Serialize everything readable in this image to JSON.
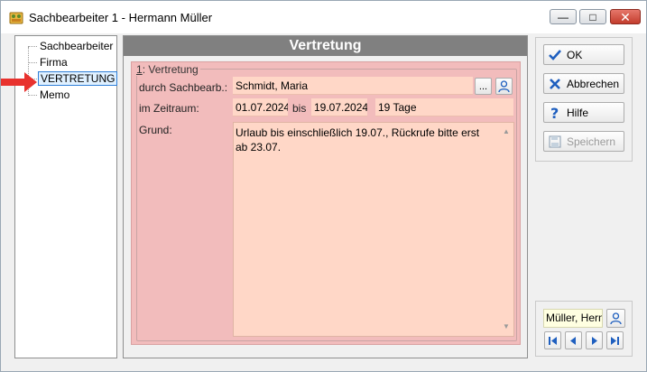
{
  "window": {
    "title": "Sachbearbeiter 1 - Hermann Müller",
    "minimize_glyph": "—",
    "maximize_glyph": "□",
    "close_glyph": "✕"
  },
  "tree": {
    "items": [
      {
        "label": "Sachbearbeiter",
        "selected": false
      },
      {
        "label": "Firma",
        "selected": false
      },
      {
        "label": "VERTRETUNG",
        "selected": true
      },
      {
        "label": "Memo",
        "selected": false
      }
    ]
  },
  "main": {
    "header": "Vertretung",
    "group_prefix": "1",
    "group_title": ": Vertretung",
    "labels": {
      "durch": "durch Sachbearb.:",
      "zeitraum": "im Zeitraum:",
      "bis": "bis",
      "grund": "Grund:"
    },
    "fields": {
      "sachbearbeiter": "Schmidt, Maria",
      "lookup_button": "...",
      "von": "01.07.2024",
      "bis": "19.07.2024",
      "dauer": "19 Tage",
      "grund": "Urlaub bis einschließlich 19.07., Rückrufe bitte erst ab 23.07."
    }
  },
  "buttons": {
    "ok": "OK",
    "abbrechen": "Abbrechen",
    "hilfe": "Hilfe",
    "speichern": "Speichern"
  },
  "nav": {
    "current": "Müller, Hermann"
  },
  "colors": {
    "field_bg": "#ffd7c7",
    "panel_bg": "#f2bcbc",
    "header_bg": "#808080",
    "accent_blue": "#1f5fbf",
    "pointer_red": "#e8322e"
  }
}
